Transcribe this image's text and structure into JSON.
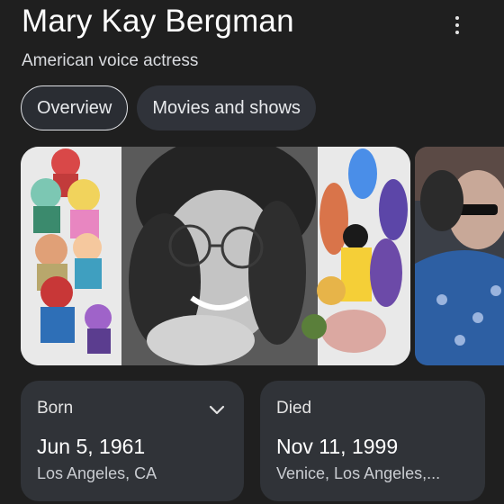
{
  "header": {
    "name": "Mary Kay Bergman",
    "description": "American voice actress",
    "more_icon": "more-vert-icon"
  },
  "tabs": [
    {
      "label": "Overview",
      "active": true
    },
    {
      "label": "Movies and shows",
      "active": false
    }
  ],
  "images": [
    {
      "subject": "portrait collage with cartoon characters"
    },
    {
      "subject": "man in sunglasses"
    }
  ],
  "facts": {
    "born": {
      "label": "Born",
      "date": "Jun 5, 1961",
      "place": "Los Angeles, CA",
      "expand_icon": "chevron-down-icon"
    },
    "died": {
      "label": "Died",
      "date": "Nov 11, 1999",
      "place": "Venice, Los Angeles,..."
    }
  },
  "colors": {
    "background": "#1f1f1f",
    "card": "#303338",
    "chip_active_border": "#dfe1e5"
  }
}
